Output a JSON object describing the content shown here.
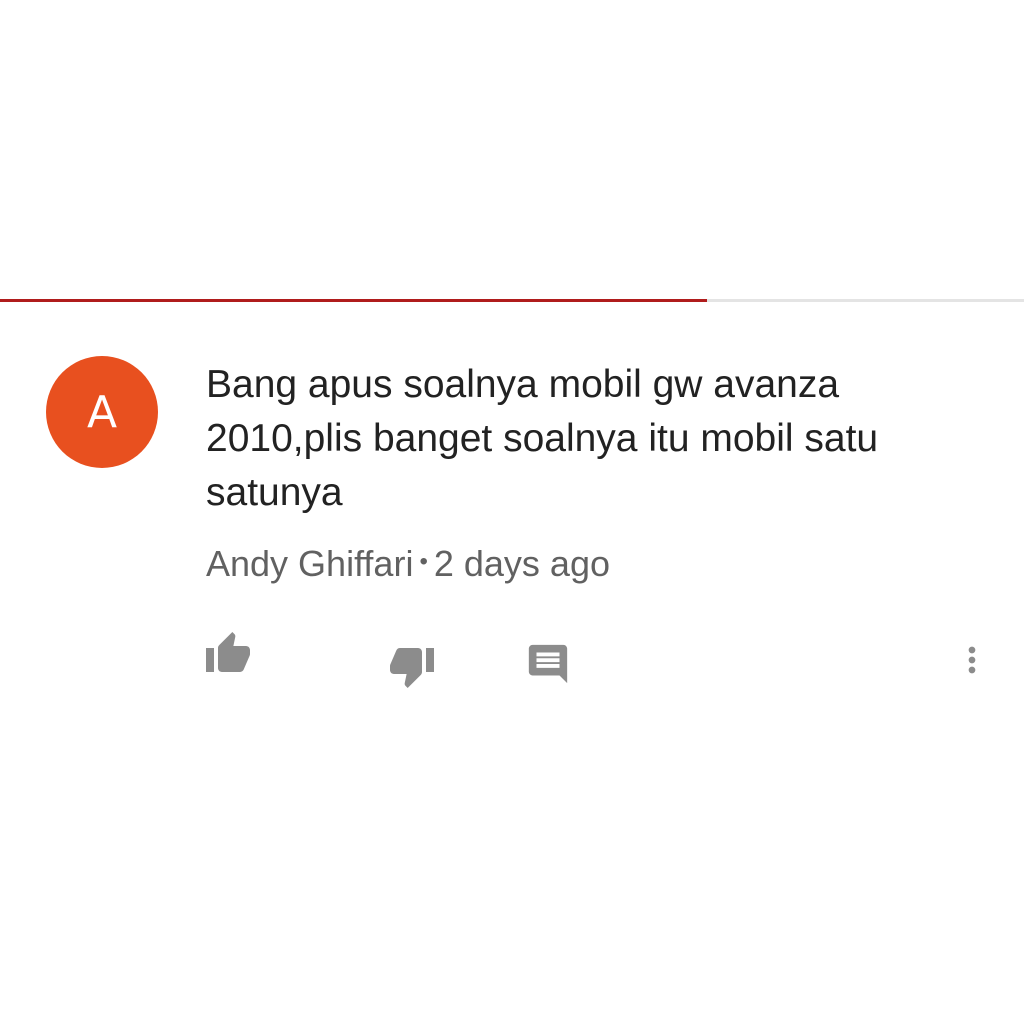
{
  "progress": {
    "fraction": 0.69,
    "fill_color": "#b01c1c",
    "track_color": "#e4e4e4"
  },
  "comment": {
    "avatar": {
      "initial": "A",
      "color": "#e8501f"
    },
    "text": "Bang apus soalnya mobil gw avanza 2010,plis banget soalnya itu mobil satu satunya",
    "author": "Andy Ghiffari",
    "separator": "•",
    "time": "2 days ago"
  },
  "actions": {
    "like_icon": "thumbs-up-icon",
    "dislike_icon": "thumbs-down-icon",
    "reply_icon": "comment-reply-icon",
    "more_icon": "more-vertical-icon",
    "icon_color": "#8c8c8c"
  }
}
